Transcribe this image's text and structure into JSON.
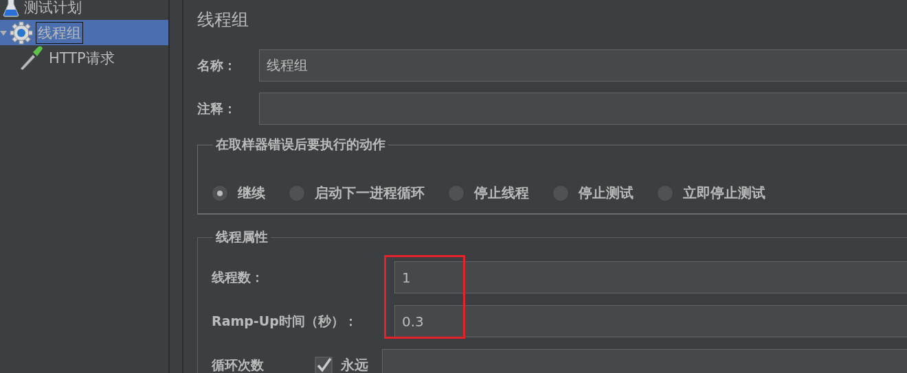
{
  "tree": [
    {
      "label": "测试计划",
      "selected": false,
      "children": [
        {
          "label": "线程组",
          "expanded": true,
          "selected": true,
          "children": [
            {
              "label": "HTTP请求",
              "selected": false
            }
          ]
        }
      ]
    }
  ],
  "panel": {
    "title": "线程组",
    "fields": [
      {
        "label": "名称：",
        "value": "线程组"
      },
      {
        "label": "注释："
      }
    ],
    "on_error": {
      "legend": "在取样器错误后要执行的动作",
      "options": [
        {
          "label": "继续",
          "selected": true
        },
        {
          "label": "启动下一进程循环",
          "selected": false
        },
        {
          "label": "停止线程",
          "selected": false
        },
        {
          "label": "停止测试",
          "selected": false
        },
        {
          "label": "立即停止测试",
          "selected": false
        }
      ]
    },
    "thread_properties": {
      "legend": "线程属性",
      "fields": [
        {
          "label": "线程数：",
          "value": "1"
        },
        {
          "label": "Ramp-Up时间（秒）：",
          "value": "0.3"
        }
      ],
      "loop": {
        "label": "循环次数",
        "checkbox_label": "永远",
        "checked": true
      }
    },
    "annotations": [
      {
        "kind": "highlight"
      }
    ]
  }
}
